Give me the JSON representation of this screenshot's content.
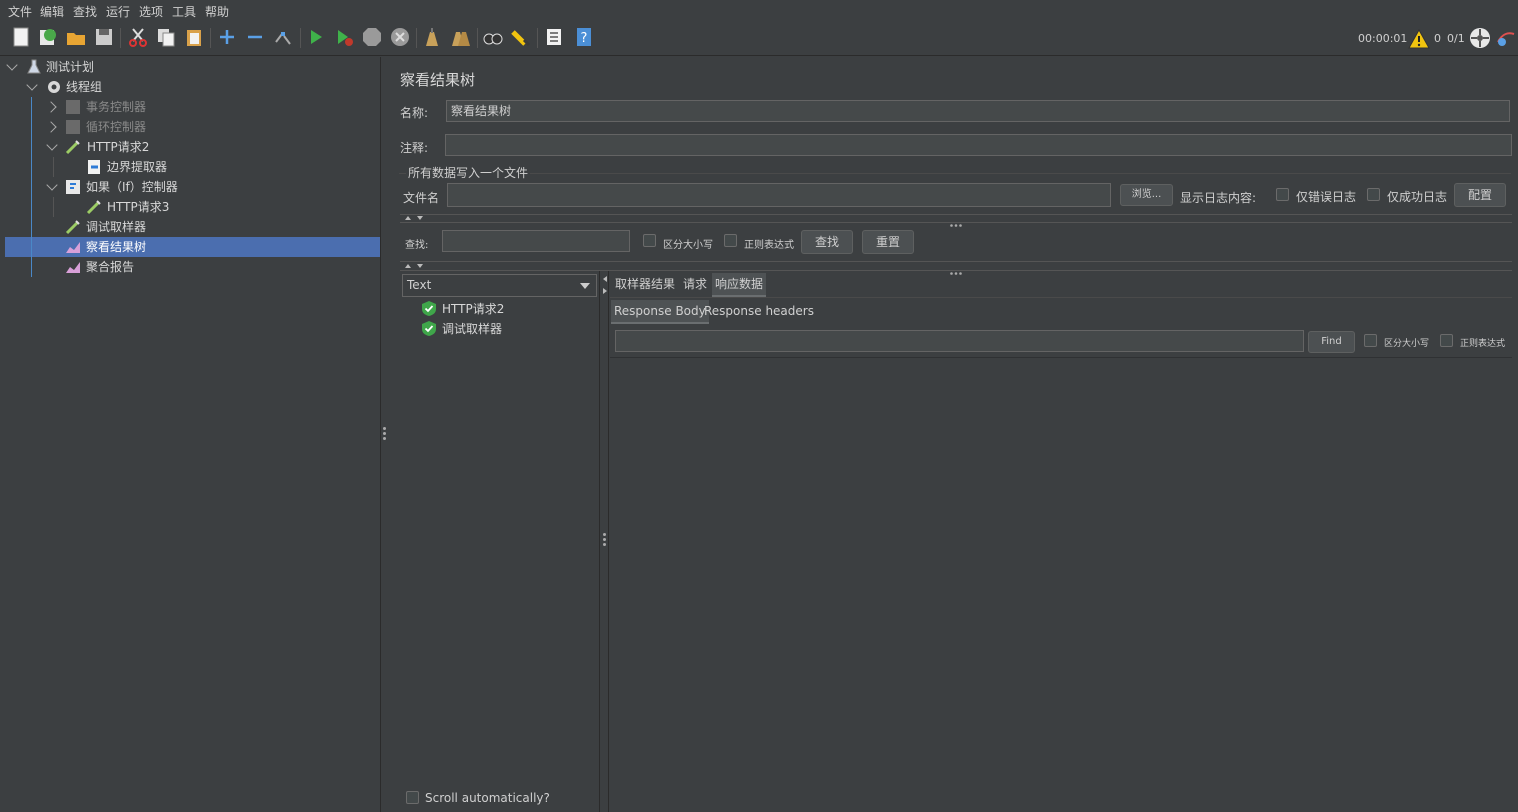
{
  "menu": [
    "文件",
    "编辑",
    "查找",
    "运行",
    "选项",
    "工具",
    "帮助"
  ],
  "toolbar_status": {
    "timer": "00:00:01",
    "warnings": "0",
    "threads": "0/1"
  },
  "tree": [
    {
      "label": "测试计划"
    },
    {
      "label": "线程组"
    },
    {
      "label": "事务控制器"
    },
    {
      "label": "循环控制器"
    },
    {
      "label": "HTTP请求2"
    },
    {
      "label": "边界提取器"
    },
    {
      "label": "如果（If）控制器"
    },
    {
      "label": "HTTP请求3"
    },
    {
      "label": "调试取样器"
    },
    {
      "label": "察看结果树"
    },
    {
      "label": "聚合报告"
    }
  ],
  "panel": {
    "title": "察看结果树",
    "name_label": "名称:",
    "name_value": "察看结果树",
    "comment_label": "注释:",
    "file_group_title": "所有数据写入一个文件",
    "file_label": "文件名",
    "browse_button": "浏览...",
    "log_label": "显示日志内容:",
    "errors_only": "仅错误日志",
    "success_only": "仅成功日志",
    "config_button": "配置",
    "search_label": "查找:",
    "case_sensitive": "区分大小写",
    "regex": "正则表达式",
    "find_button": "查找",
    "reset_button": "重置"
  },
  "results": {
    "renderer": "Text",
    "samples": [
      "HTTP请求2",
      "调试取样器"
    ],
    "scroll_auto": "Scroll automatically?",
    "tabs": [
      "取样器结果",
      "请求",
      "响应数据"
    ],
    "subtabs": [
      "Response Body",
      "Response headers"
    ],
    "find_button": "Find",
    "case_sensitive": "区分大小写",
    "regex": "正则表达式"
  },
  "colors": {
    "background": "#3c3f41",
    "selection": "#4b6eaf",
    "success": "#3fa64a",
    "warning": "#f1c40f"
  }
}
